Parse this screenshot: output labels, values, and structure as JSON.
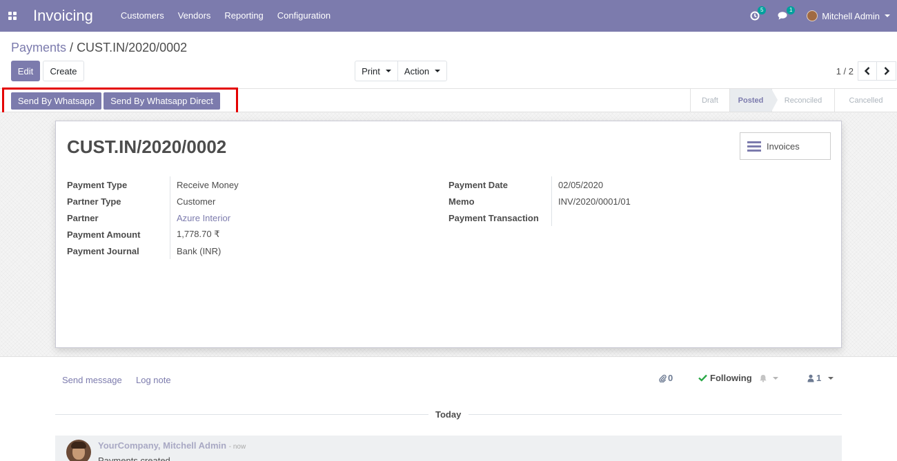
{
  "navbar": {
    "app_name": "Invoicing",
    "menu": [
      "Customers",
      "Vendors",
      "Reporting",
      "Configuration"
    ],
    "activity_count": "5",
    "message_count": "1",
    "user_name": "Mitchell Admin",
    "background_color": "#7c7bad"
  },
  "breadcrumb": {
    "parent": "Payments",
    "separator": "/",
    "current": "CUST.IN/2020/0002"
  },
  "toolbar": {
    "edit_label": "Edit",
    "create_label": "Create",
    "print_label": "Print",
    "action_label": "Action"
  },
  "pager": {
    "value": "1 / 2"
  },
  "header_buttons": {
    "send_whatsapp": "Send By Whatsapp",
    "send_whatsapp_direct": "Send By Whatsapp Direct"
  },
  "statusbar": {
    "stages": [
      {
        "label": "Draft",
        "active": false
      },
      {
        "label": "Posted",
        "active": true
      },
      {
        "label": "Reconciled",
        "active": false
      },
      {
        "label": "Cancelled",
        "active": false
      }
    ]
  },
  "form": {
    "title": "CUST.IN/2020/0002",
    "smart_button_label": "Invoices",
    "left_fields": [
      {
        "label": "Payment Type",
        "value": "Receive Money"
      },
      {
        "label": "Partner Type",
        "value": "Customer"
      },
      {
        "label": "Partner",
        "value": "Azure Interior"
      },
      {
        "label": "Payment Amount",
        "value": "1,778.70 ₹"
      },
      {
        "label": "Payment Journal",
        "value": "Bank (INR)"
      }
    ],
    "right_fields": [
      {
        "label": "Payment Date",
        "value": "02/05/2020"
      },
      {
        "label": "Memo",
        "value": "INV/2020/0001/01"
      },
      {
        "label": "Payment Transaction",
        "value": ""
      }
    ]
  },
  "chatter": {
    "send_message": "Send message",
    "log_note": "Log note",
    "attachment_count": "0",
    "following_label": "Following",
    "follower_count": "1",
    "date_separator": "Today",
    "message": {
      "author": "YourCompany, Mitchell Admin",
      "time": "- now",
      "body": "Payments created"
    }
  },
  "colors": {
    "primary": "#7c7bad",
    "highlight_box": "#e40000",
    "following_check": "#28a745",
    "badge": "#00a09d"
  }
}
